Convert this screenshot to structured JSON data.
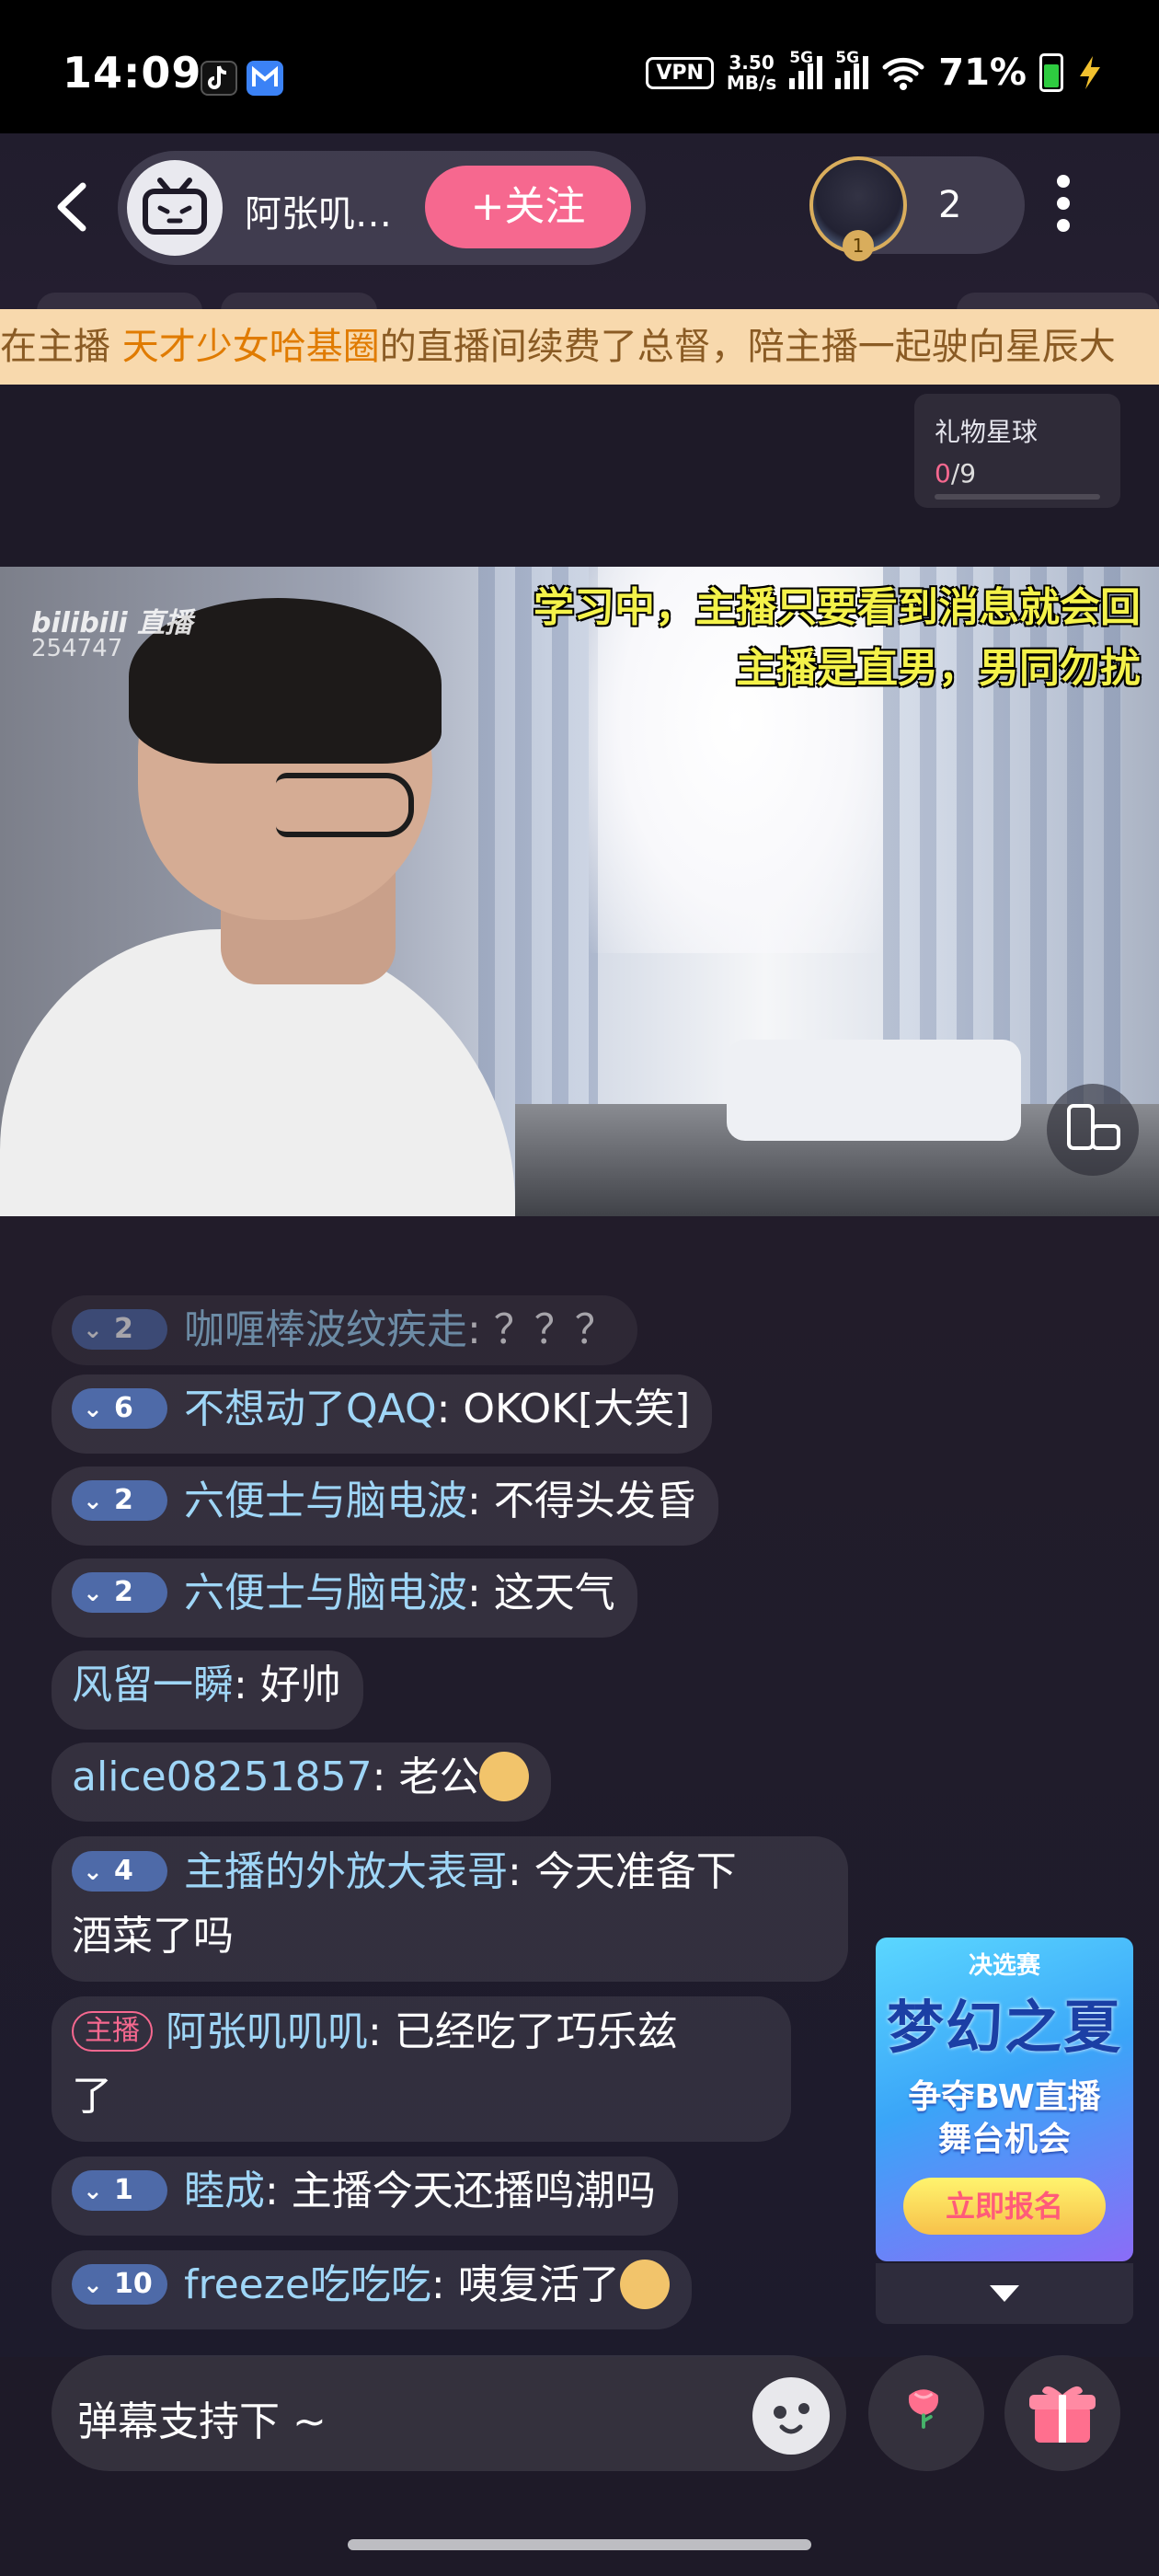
{
  "status_bar": {
    "time": "14:09",
    "vpn": "VPN",
    "net_speed_value": "3.50",
    "net_speed_unit": "MB/s",
    "sim1": "5G",
    "sim2": "5G",
    "battery": "71%",
    "icons": [
      "tiktok-icon",
      "mail-icon",
      "wifi-icon",
      "battery-icon",
      "charging-icon"
    ]
  },
  "header": {
    "anchor_name": "阿张叽…",
    "follow_label": "+关注",
    "viewer_count": "2",
    "viewer_rank": "1"
  },
  "marquee": {
    "prefix": "在主播 ",
    "highlight": "天才少女哈基圈",
    "suffix": "的直播间续费了总督，陪主播一起驶向星辰大"
  },
  "gift_planet": {
    "title": "礼物星球",
    "current": "0",
    "total": "/9"
  },
  "video": {
    "watermark": "bilibili 直播",
    "room_id": "254747",
    "overlay_line1": "学习中，主播只要看到消息就会回",
    "overlay_line2": "主播是直男，男同勿扰"
  },
  "chat": [
    {
      "level": "2",
      "name": "咖喱棒波纹疾走",
      "text": ": ？？？"
    },
    {
      "level": "6",
      "name": "不想动了QAQ",
      "text": ": OKOK[大笑]"
    },
    {
      "level": "2",
      "name": "六便士与脑电波",
      "text": ": 不得头发昏"
    },
    {
      "level": "2",
      "name": "六便士与脑电波",
      "text": ": 这天气"
    },
    {
      "level": "",
      "name": "风留一瞬",
      "text": ": 好帅"
    },
    {
      "level": "",
      "name": "alice08251857",
      "text": ": 老公"
    },
    {
      "level": "4",
      "name": "主播的外放大表哥",
      "text": ": 今天准备下",
      "text2": "酒菜了吗"
    },
    {
      "tag": "主播",
      "name": "阿张叽叽叽",
      "text": ": 已经吃了巧乐兹",
      "text2": "了"
    },
    {
      "level": "1",
      "name": "睦成",
      "text": ": 主播今天还播鸣潮吗"
    },
    {
      "level": "10",
      "name": "freeze吃吃吃",
      "text": ": 咦复活了"
    }
  ],
  "promo": {
    "tag": "决选赛",
    "title": "梦幻之夏",
    "sub_line1": "争夺BW直播",
    "sub_line2": "舞台机会",
    "cta": "立即报名"
  },
  "input": {
    "placeholder": "弹幕支持下 ~"
  },
  "colors": {
    "accent_pink": "#f6688f",
    "name_blue": "#9fd6f7",
    "overlay_yellow": "#f4f24a",
    "marquee_bg": "#f8d9ad"
  }
}
